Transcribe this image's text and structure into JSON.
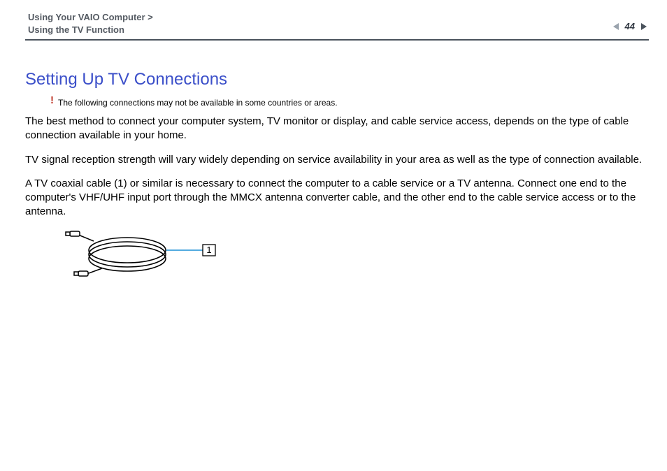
{
  "header": {
    "breadcrumb_line1": "Using Your VAIO Computer >",
    "breadcrumb_line2": "Using the TV Function",
    "page_number": "44"
  },
  "content": {
    "title": "Setting Up TV Connections",
    "warning_mark": "!",
    "warning_text": "The following connections may not be available in some countries or areas.",
    "para1": "The best method to connect your computer system, TV monitor or display, and cable service access, depends on the type of cable connection available in your home.",
    "para2": "TV signal reception strength will vary widely depending on service availability in your area as well as the type of connection available.",
    "para3": "A TV coaxial cable (1) or similar is necessary to connect the computer to a cable service or a TV antenna. Connect one end to the computer's VHF/UHF input port through the MMCX antenna converter cable, and the other end to the cable service access or to the antenna.",
    "callout_label": "1"
  }
}
